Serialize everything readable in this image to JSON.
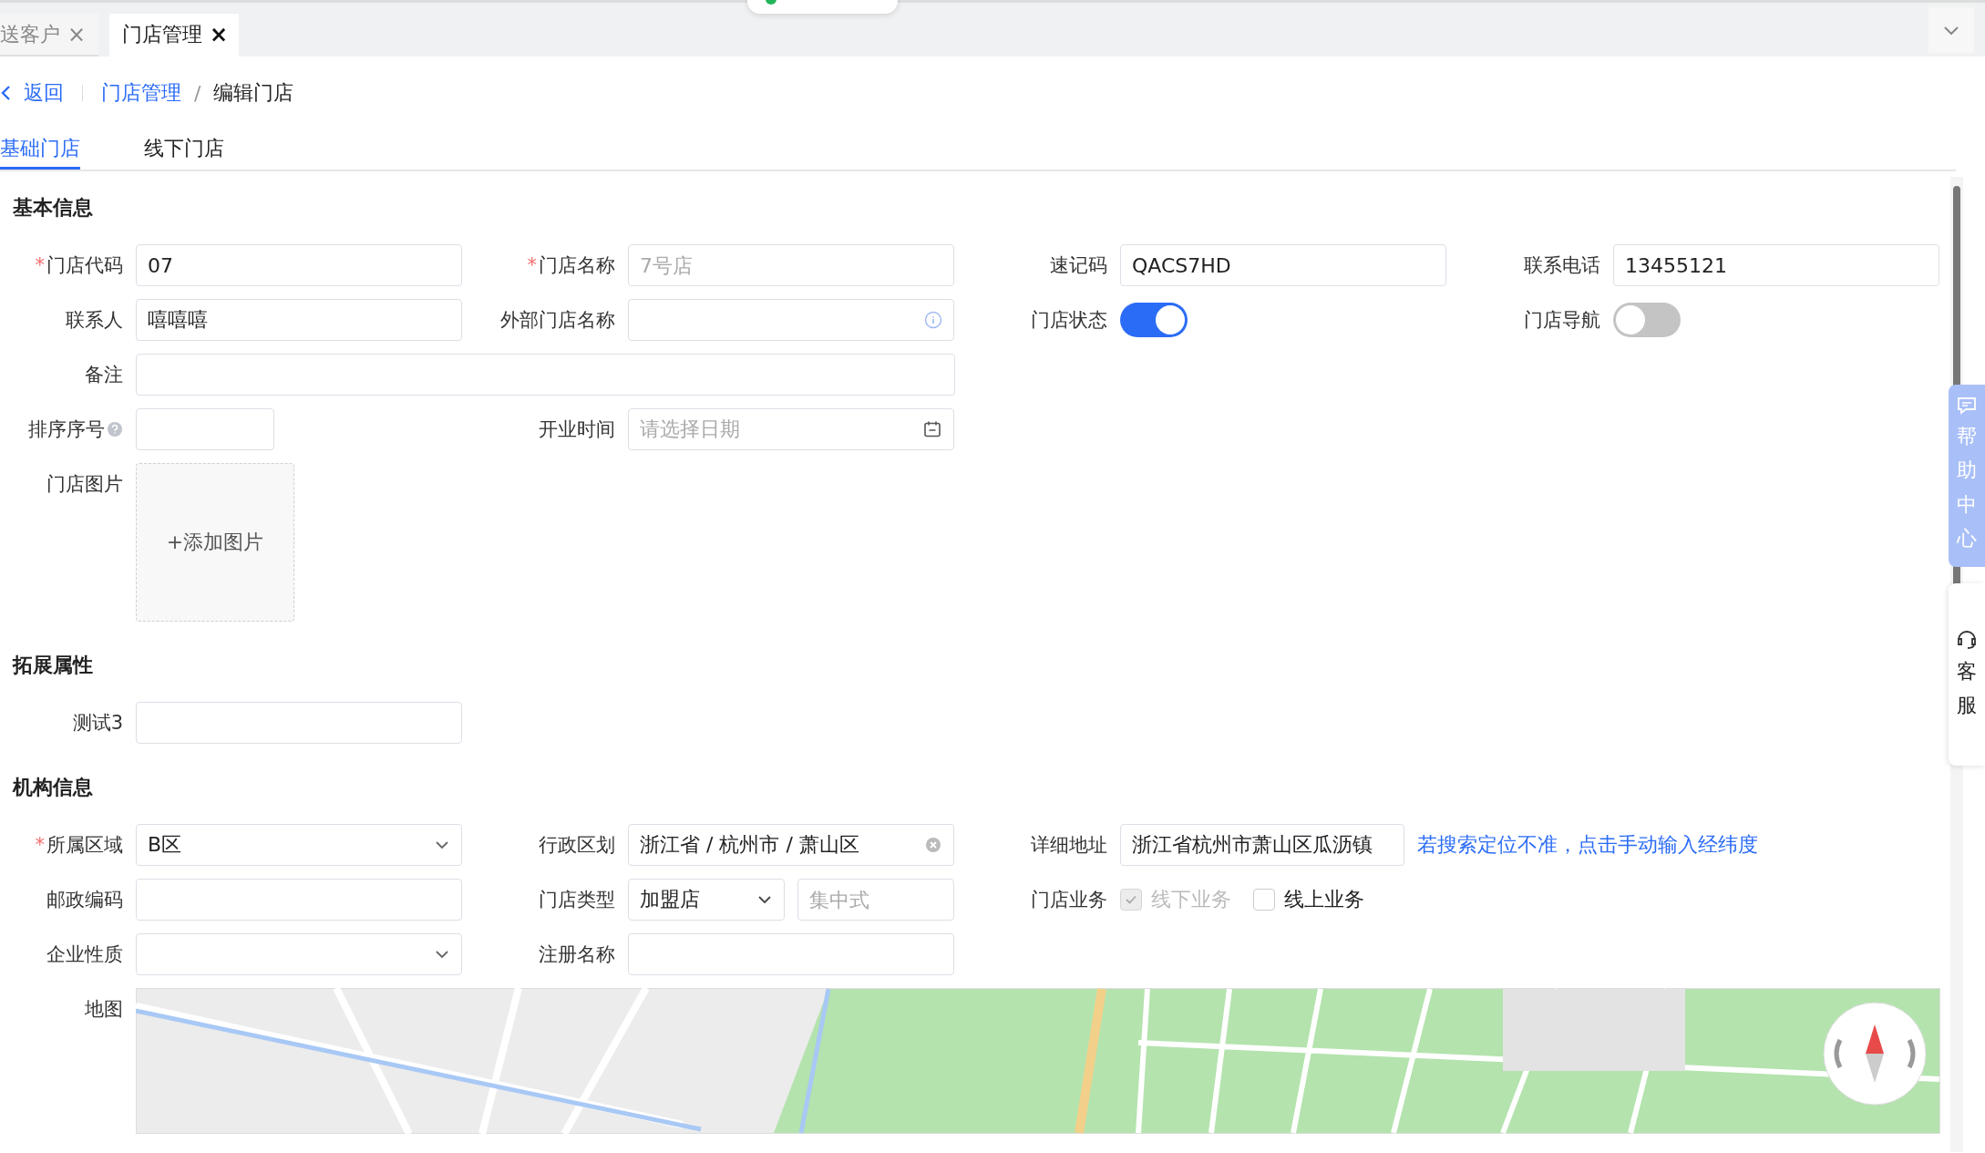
{
  "top_tabs": [
    {
      "label": "送客户",
      "close": "×",
      "selected": false
    },
    {
      "label": "门店管理",
      "close": "×",
      "selected": true
    }
  ],
  "breadcrumb": {
    "back": "返回",
    "items": [
      "门店管理",
      "编辑门店"
    ],
    "separator": "/"
  },
  "page_tabs": [
    {
      "label": "基础门店",
      "selected": true
    },
    {
      "label": "线下门店",
      "selected": false
    }
  ],
  "sections": [
    {
      "title": "基本信息",
      "rows": [
        [
          {
            "kind": "input",
            "mark": "*",
            "label": "门店代码",
            "value": "07"
          },
          {
            "kind": "input",
            "mark": "*",
            "label": "门店名称",
            "placeholder": "7号店"
          },
          {
            "kind": "input",
            "label": "速记码",
            "value": "QACS7HD"
          },
          {
            "kind": "input",
            "label": "联系电话",
            "value": "13455121"
          }
        ],
        [
          {
            "kind": "input",
            "label": "联系人",
            "value": "嘻嘻嘻"
          },
          {
            "kind": "info-input",
            "label": "外部门店名称"
          },
          {
            "kind": "switch",
            "label": "门店状态",
            "on": true
          },
          {
            "kind": "switch",
            "label": "门店导航",
            "on": false
          }
        ],
        [
          {
            "kind": "wide-input",
            "label": "备注"
          }
        ],
        [
          {
            "kind": "short-input",
            "label": "排序序号",
            "help": true
          },
          {
            "kind": "date",
            "label": "开业时间",
            "placeholder": "请选择日期"
          }
        ],
        [
          {
            "kind": "upload",
            "label": "门店图片",
            "button": "+添加图片"
          }
        ]
      ]
    },
    {
      "title": "拓展属性",
      "rows": [
        [
          {
            "kind": "input",
            "label": "测试3"
          }
        ]
      ]
    },
    {
      "title": "机构信息",
      "rows": [
        [
          {
            "kind": "select",
            "mark": "*",
            "label": "所属区域",
            "value": "B区"
          },
          {
            "kind": "cascader",
            "label": "行政区划",
            "value": "浙江省 / 杭州市 / 萧山区"
          },
          {
            "kind": "address",
            "label": "详细地址",
            "value": "浙江省杭州市萧山区瓜沥镇",
            "link": "若搜索定位不准，点击手动输入经纬度"
          }
        ],
        [
          {
            "kind": "input",
            "label": "邮政编码"
          },
          {
            "kind": "type-select",
            "label": "门店类型",
            "value": "加盟店",
            "placeholder": "集中式"
          },
          {
            "kind": "checks",
            "label": "门店业务",
            "options": [
              {
                "label": "线下业务",
                "checked": true,
                "disabled": true
              },
              {
                "label": "线上业务",
                "checked": false,
                "disabled": false
              }
            ]
          }
        ],
        [
          {
            "kind": "select",
            "label": "企业性质"
          },
          {
            "kind": "input",
            "label": "注册名称"
          }
        ],
        [
          {
            "kind": "map",
            "label": "地图"
          }
        ]
      ]
    }
  ],
  "help_panel": {
    "label": "帮助中心"
  },
  "service_panel": {
    "label": "客服"
  }
}
